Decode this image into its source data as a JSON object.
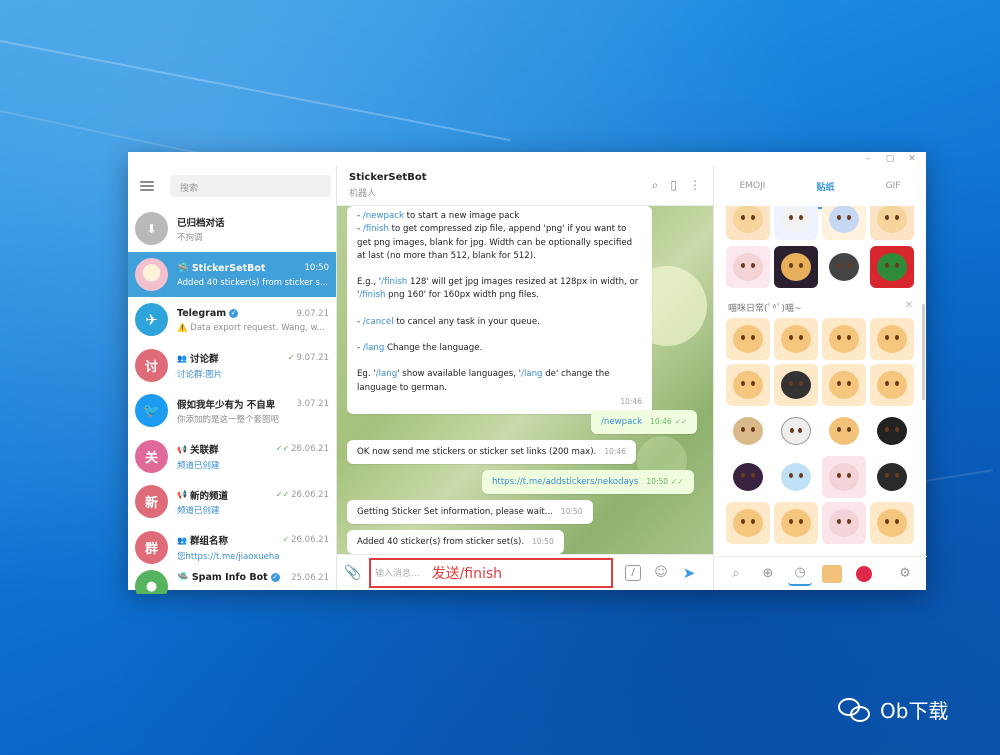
{
  "window": {
    "controls": [
      "–",
      "▢",
      "✕"
    ]
  },
  "sidebar": {
    "search_placeholder": "搜索",
    "chats": [
      {
        "name": "已归档对话",
        "time": "",
        "sub": "不拘调",
        "avatar_color": "#b9b9b9",
        "avatar_text": "⬇",
        "active": false,
        "sub_blue": false
      },
      {
        "name": "StickerSetBot",
        "time": "10:50",
        "sub": "Added 40 sticker(s) from sticker s...",
        "avatar_color": "#f3d2dc",
        "avatar_text": "",
        "active": true,
        "sub_blue": false
      },
      {
        "name": "Telegram",
        "time": "9.07.21",
        "sub": "⚠️ Data export request. Wang, w...",
        "avatar_color": "#2fa3dc",
        "avatar_text": "✈",
        "active": false,
        "sub_blue": false
      },
      {
        "name": "讨论群",
        "time": "9.07.21",
        "sub": "讨论群:图片",
        "avatar_color": "#e06b78",
        "avatar_text": "讨",
        "active": false,
        "sub_blue": true
      },
      {
        "name": "假如我年少有为 不自卑",
        "time": "3.07.21",
        "sub": "你添加的是这一整个套图吧",
        "avatar_color": "#1d9bf0",
        "avatar_text": "🐦",
        "active": false,
        "sub_blue": false
      },
      {
        "name": "关联群",
        "time": "26.06.21",
        "sub": "频道已创建",
        "avatar_color": "#e06b9a",
        "avatar_text": "关",
        "active": false,
        "sub_blue": true
      },
      {
        "name": "新的频道",
        "time": "26.06.21",
        "sub": "频道已创建",
        "avatar_color": "#e06b78",
        "avatar_text": "新",
        "active": false,
        "sub_blue": true
      },
      {
        "name": "群组名称",
        "time": "26.06.21",
        "sub": "您https://t.me/jiaoxueha",
        "avatar_color": "#e06b78",
        "avatar_text": "群",
        "active": false,
        "sub_blue": true
      },
      {
        "name": "Spam Info Bot",
        "time": "25.06.21",
        "sub": "",
        "avatar_color": "#56b45e",
        "avatar_text": "●",
        "active": false,
        "sub_blue": false
      }
    ]
  },
  "chat": {
    "title": "StickerSetBot",
    "subtitle": "机器人",
    "input_placeholder": "输入消息...",
    "input_overlay": "发送/finish",
    "help": {
      "l1_cmd": "/newpack",
      "l1_rest": " to start a new image pack",
      "l2_cmd": "/finish",
      "l2_rest": " to get compressed zip file, append 'png' if you want to get png images, blank for jpg. Width can be optionally specified at last (no more than 512, blank for 512).",
      "l3_pre": "E.g., '",
      "l3_cmd": "/finish",
      "l3_mid": " 128' will get jpg images resized at 128px in width, or '",
      "l3_cmd2": "/finish",
      "l3_rest": " png 160' for 160px width png files.",
      "l4_cmd": "/cancel",
      "l4_rest": " to cancel any task in your queue.",
      "l5_cmd": "/lang",
      "l5_rest": " Change the language.",
      "l6_pre": "Eg. '",
      "l6_cmd": "/lang",
      "l6_mid": "' show available languages, '",
      "l6_cmd2": "/lang",
      "l6_rest": " de' change the language to german.",
      "time": "10:46"
    },
    "messages": [
      {
        "text": "/newpack",
        "time": "10:46",
        "out": true
      },
      {
        "text": "OK now send me stickers or sticker set links (200 max).",
        "time": "10:46",
        "out": false
      },
      {
        "text": "https://t.me/addstickers/nekodays",
        "time": "10:50",
        "out": true
      },
      {
        "text": "Getting Sticker Set information, please wait...",
        "time": "10:50",
        "out": false
      },
      {
        "text": "Added 40 sticker(s) from sticker set(s).",
        "time": "10:50",
        "out": false
      }
    ]
  },
  "panel": {
    "tabs": [
      "EMOJI",
      "贴纸",
      "GIF"
    ],
    "active_tab": 1,
    "pack_title": "喵咪日常(ﾟ^ﾟ)喵~"
  },
  "watermark": "Ob下载"
}
